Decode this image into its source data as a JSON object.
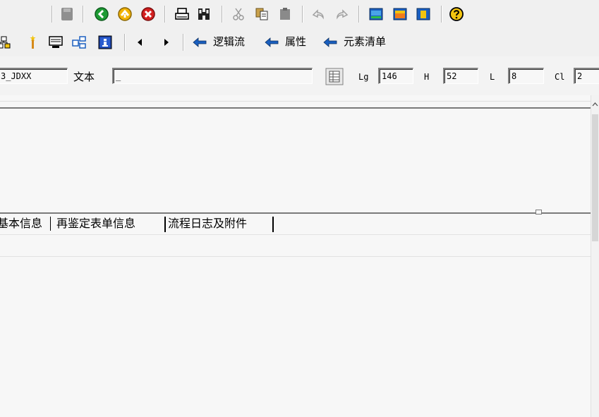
{
  "toolbar_standard": {
    "icons": [
      "save-icon",
      "back-icon",
      "exit-icon",
      "cancel-icon",
      "print-icon",
      "find-icon",
      "cut-icon",
      "copy-icon",
      "paste-icon",
      "undo-icon",
      "redo-icon",
      "window-blue-icon",
      "window-orange-icon",
      "window-yellow-icon",
      "help-icon"
    ]
  },
  "toolbar_app": {
    "icons": [
      "hierarchy-icon",
      "wand-icon",
      "screen-icon",
      "layout-icon",
      "info-icon",
      "prev-icon",
      "next-icon"
    ],
    "logic_flow_label": "逻辑流",
    "attributes_label": "属性",
    "element_list_label": "元素清单"
  },
  "element_attrs": {
    "name_value": "3_JDXX",
    "text_label": "文本",
    "text_value": "_",
    "lg_label": "Lg",
    "lg_value": "146",
    "h_label": "H",
    "h_value": "52",
    "l_label": "L",
    "l_value": "8",
    "cl_label": "Cl",
    "cl_value": "2"
  },
  "tabs": [
    {
      "label": "基本信息"
    },
    {
      "label": "再鉴定表单信息"
    },
    {
      "label": "流程日志及附件"
    }
  ],
  "colors": {
    "toolbar_bg": "#f0f0f0",
    "screen_bg": "#f7f7f7",
    "accent_blue": "#1a5fbf",
    "help_yellow": "#f2c40f"
  }
}
